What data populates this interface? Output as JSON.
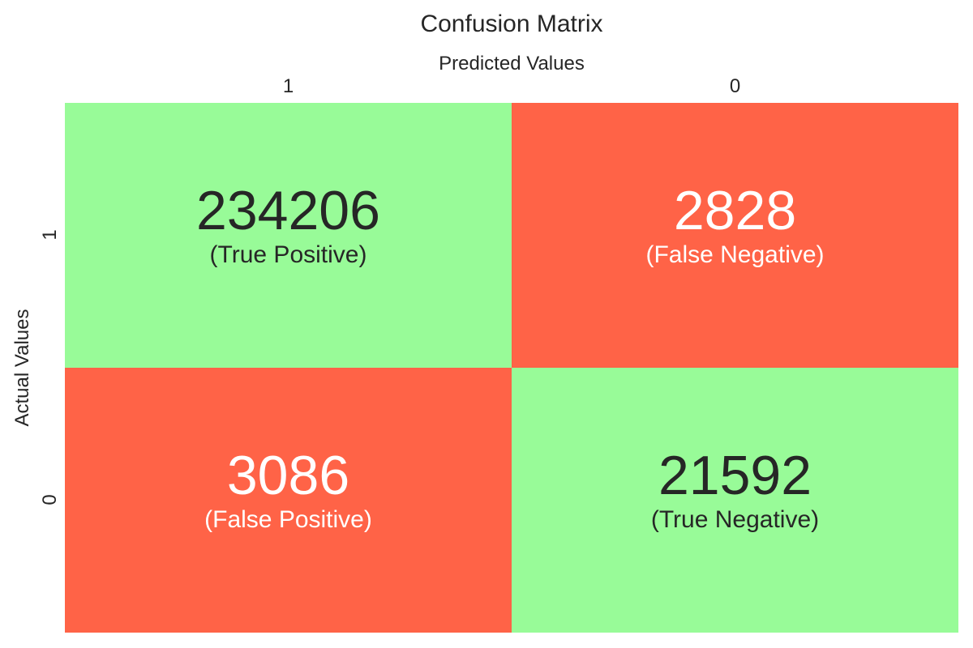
{
  "chart_data": {
    "type": "heatmap",
    "title": "Confusion Matrix",
    "xlabel": "Predicted Values",
    "ylabel": "Actual Values",
    "x_ticks": [
      "1",
      "0"
    ],
    "y_ticks": [
      "1",
      "0"
    ],
    "cells": [
      [
        {
          "value": "234206",
          "caption": "(True Positive)",
          "fill": "#98FB98",
          "text_color": "#262626"
        },
        {
          "value": "2828",
          "caption": "(False Negative)",
          "fill": "#FF6347",
          "text_color": "#FFFFFF"
        }
      ],
      [
        {
          "value": "3086",
          "caption": "(False Positive)",
          "fill": "#FF6347",
          "text_color": "#FFFFFF"
        },
        {
          "value": "21592",
          "caption": "(True Negative)",
          "fill": "#98FB98",
          "text_color": "#262626"
        }
      ]
    ]
  }
}
